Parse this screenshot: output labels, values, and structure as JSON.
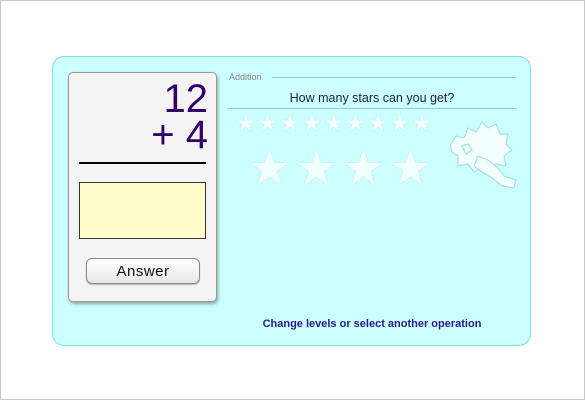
{
  "problem": {
    "operand_top": "12",
    "operand_bottom": "+ 4",
    "answer_value": "",
    "answer_button_label": "Answer"
  },
  "header": {
    "operation_label": "Addition",
    "question": "How many stars can you get?"
  },
  "stars": {
    "small_count": 9,
    "large_count": 4,
    "earned": 0,
    "icon": "star-icon"
  },
  "mascot": {
    "icon": "mascot-silhouette-icon"
  },
  "footer": {
    "levels_link": "Change levels or select another operation"
  },
  "colors": {
    "panel_background": "#ccffff",
    "digits": "#33006b",
    "answer_field": "#ffffcc",
    "link": "#2a1a8a",
    "star_outline": "#a9dfe3"
  }
}
